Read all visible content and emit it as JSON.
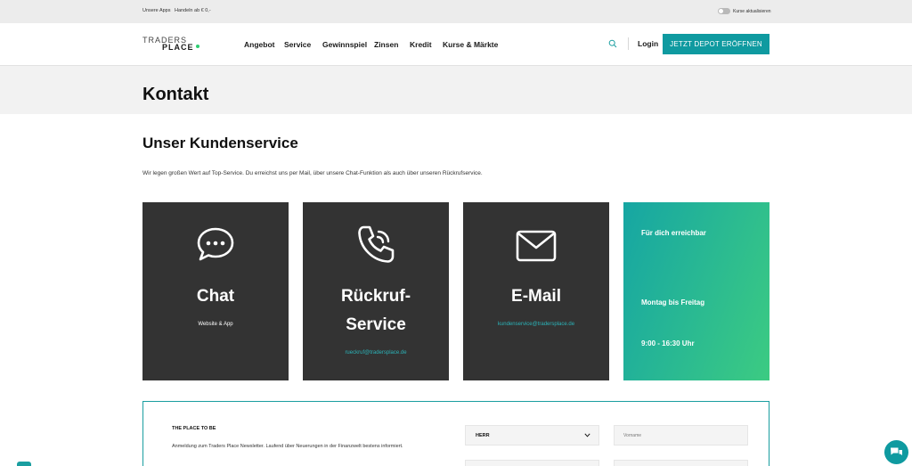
{
  "topbar": {
    "links": [
      "Unsere Apps",
      "Handeln ab € 0,-"
    ],
    "toggle_label": "Kurse aktualisieren"
  },
  "header": {
    "logo_line1": "TRADERS",
    "logo_line2": "PLACE",
    "nav": [
      "Angebot",
      "Service",
      "Gewinnspiel",
      "Zinsen",
      "Kredit",
      "Kurse & Märkte"
    ],
    "login": "Login",
    "cta": "JETZT DEPOT ERÖFFNEN"
  },
  "page": {
    "title": "Kontakt",
    "section_title": "Unser Kundenservice",
    "intro": "Wir legen großen Wert auf Top-Service. Du erreichst uns per Mail, über unsere Chat-Funktion als auch über unseren Rückrufservice."
  },
  "cards": {
    "chat": {
      "title": "Chat",
      "sub": "Website & App",
      "icon": "chat-bubble-icon"
    },
    "callback": {
      "title_line1": "Rückruf-",
      "title_line2": "Service",
      "sub": "rueckruf@tradersplace.de",
      "icon": "phone-icon"
    },
    "email": {
      "title": "E-Mail",
      "sub": "kundenservice@tradersplace.de",
      "icon": "envelope-icon"
    },
    "availability": {
      "heading": "Für dich erreichbar",
      "days": "Montag bis Freitag",
      "hours": "9:00 - 16:30 Uhr"
    }
  },
  "newsletter": {
    "title": "THE PLACE TO BE",
    "text": "Anmeldung zum Traders Place Newsletter. Laufend über Neuerungen in der Finanzwelt bestens informiert.",
    "salutation_value": "HERR",
    "firstname_placeholder": "Vorname"
  },
  "colors": {
    "accent": "#0f9aa0",
    "card_dark": "#333333",
    "gradient_start": "#16a6a3",
    "gradient_end": "#3ccb82"
  }
}
